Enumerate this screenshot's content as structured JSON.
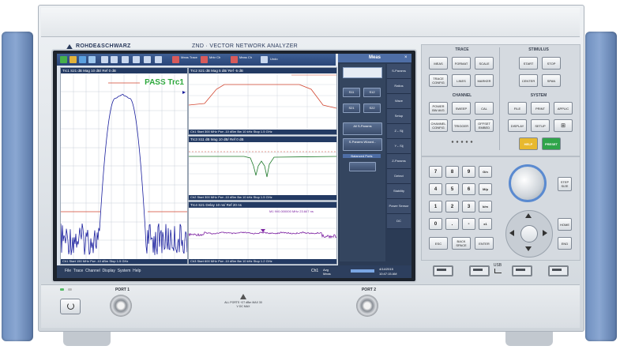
{
  "brand": "ROHDE&SCHWARZ",
  "model_title": "ZND · VECTOR NETWORK ANALYZER",
  "toolbar": {
    "labels": [
      "Meas Trace",
      "Mrkr Ch",
      "Meas Ch",
      "Undo"
    ]
  },
  "main_plot": {
    "header": "Trc1 S21 dB Mag 10 dB/ Ref 0 dB",
    "pass_text": "PASS Trc1",
    "footer": "Ch1 Start 150 MHz   Pwr -10 dBm   Stop 1.5 GHz"
  },
  "sub_plots": [
    {
      "header": "Trc2 S21 dB Mag 5 dB/ Ref -5 dB",
      "footer": "Ch1 Start 300 MHz   Pwr -10 dBm   Bw 10 kHz   Stop 1.5 GHz"
    },
    {
      "header": "Trc3 S11 dB Mag 10 dB/ Ref 0 dB",
      "footer": "Ch2 Start 300 MHz   Pwr -10 dBm   Bw 10 kHz   Stop 1.5 GHz"
    },
    {
      "header": "Trc4 S21 Delay 10 ns/ Ref 20 ns",
      "marker_text": "M1 900.000000 MHz 23.667 ns",
      "footer": "Ch3 Start 600 MHz   Pwr -10 dBm   Bw 10 kHz   Stop 1.2 GHz"
    }
  ],
  "meas_panel": {
    "title": "Meas",
    "sparams": [
      "S11",
      "S12",
      "S21",
      "S22"
    ],
    "side_items": [
      "S-Params",
      "Ratios",
      "Wave",
      "Setup",
      "Z←Sij",
      "Y←Sij",
      "Z-Params",
      "Detect",
      "Stability",
      "Power Sensor",
      "DC"
    ],
    "all_label": "All S-Params",
    "wizard_label": "S-Params Wizard...",
    "balanced_label": "Balanced Ports"
  },
  "menubar": "File  Trace  Channel  Display  System  Help",
  "status": {
    "ch": "Ch1",
    "avg": "Avg Meas",
    "date": "4/14/2015",
    "time": "10:47:15 AM"
  },
  "trace_section": {
    "title": "TRACE",
    "buttons": [
      "MEAS",
      "FORMAT",
      "SCALE",
      "TRACE CONFIG",
      "LINES",
      "MARKER"
    ]
  },
  "stimulus_section": {
    "title": "STIMULUS",
    "buttons": [
      "START",
      "STOP",
      "CENTER",
      "SPAN"
    ]
  },
  "channel_section": {
    "title": "CHANNEL",
    "buttons": [
      "POWER BW AVG",
      "SWEEP",
      "CAL",
      "CHANNEL CONFIG",
      "TRIGGER",
      "OFFSET EMBED"
    ]
  },
  "system_section": {
    "title": "SYSTEM",
    "buttons": [
      "FILE",
      "PRINT",
      "APPLIC",
      "DISPLAY",
      "SETUP",
      "⊞"
    ],
    "help": "HELP",
    "preset": "PRESET"
  },
  "keypad": {
    "keys": [
      "7",
      "8",
      "9",
      "G/n",
      "4",
      "5",
      "6",
      "M/µ",
      "1",
      "2",
      "3",
      "k/m",
      "0",
      ".",
      "-",
      "x1"
    ],
    "esc": "ESC",
    "back": "BACK SPACE",
    "enter": "ENTER"
  },
  "nav": {
    "step": "STEP SIZE",
    "home": "HOME",
    "end": "END"
  },
  "front": {
    "port1": "PORT 1",
    "port2": "PORT 2",
    "usb": "USB",
    "warning": "ALL PORTS +27 dBm MAX 30 V DC MAX"
  },
  "colors": {
    "trace_blue": "#1a1f9e",
    "trace_red": "#d2452f",
    "trace_green": "#1e7a2a",
    "trace_purple": "#7a1ea0",
    "help_yellow": "#e8b92e",
    "preset_green": "#2fa44a"
  }
}
